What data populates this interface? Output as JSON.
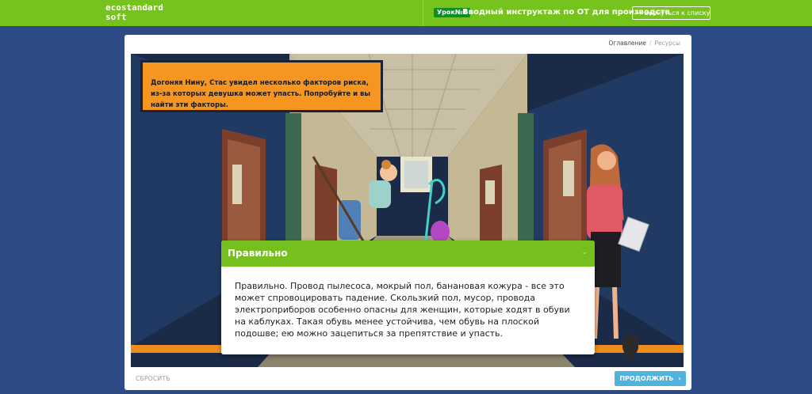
{
  "app": {
    "logo_line1": "ecostandard",
    "logo_line2": "soft"
  },
  "header": {
    "lesson_badge": "Урок№1",
    "lesson_title": "Вводный инструктаж по ОТ для производств",
    "back_label": "Вернуться к списку"
  },
  "card_nav": {
    "contents": "Оглавление",
    "resources": "Ресурсы"
  },
  "task": {
    "text": "Догоняя Нину, Стас увидел несколько факторов риска, из-за которых девушка может упасть. Попробуйте и вы найти эти факторы."
  },
  "feedback": {
    "title": "Правильно",
    "body": "Правильно. Провод пылесоса, мокрый пол, банановая кожура - все это может спровоцировать падение. Скользкий пол, мусор, провода электроприборов особенно опасны для женщин, которые ходят в обуви на каблуках. Такая обувь менее устойчива, чем обувь на плоской подошве; ею можно зацепиться за препятствие и упасть."
  },
  "footer": {
    "reset_label": "СБРОСИТЬ",
    "continue_label": "ПРОДОЛЖИТЬ"
  },
  "colors": {
    "topbar": "#77c31d",
    "page_bg": "#2c4b87",
    "task_box": "#f79521",
    "feedback_header": "#75bf1e",
    "continue_button": "#4fb3dc"
  }
}
